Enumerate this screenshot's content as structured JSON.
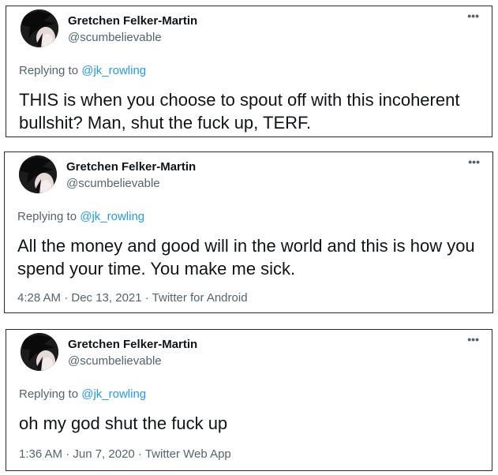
{
  "tweets": [
    {
      "display_name": "Gretchen Felker-Martin",
      "handle": "@scumbelievable",
      "more_icon": "•••",
      "replying_prefix": "Replying to ",
      "replying_to": "@jk_rowling",
      "text": "THIS is when you choose to spout off with this incoherent bullshit? Man, shut the fuck up, TERF."
    },
    {
      "display_name": "Gretchen Felker-Martin",
      "handle": "@scumbelievable",
      "more_icon": "•••",
      "replying_prefix": "Replying to ",
      "replying_to": "@jk_rowling",
      "text": "All the money and good will in the world and this is how you spend your time. You make me sick.",
      "meta": "4:28 AM · Dec 13, 2021 · Twitter for Android"
    },
    {
      "display_name": "Gretchen Felker-Martin",
      "handle": "@scumbelievable",
      "more_icon": "•••",
      "replying_prefix": "Replying to ",
      "replying_to": "@jk_rowling",
      "text": "oh my god shut the fuck up",
      "meta": "1:36 AM · Jun 7, 2020 · Twitter Web App"
    }
  ],
  "colors": {
    "text": "#0f1419",
    "secondary": "#536471",
    "link": "#1d9bf0",
    "border": "#2b2b2b"
  }
}
